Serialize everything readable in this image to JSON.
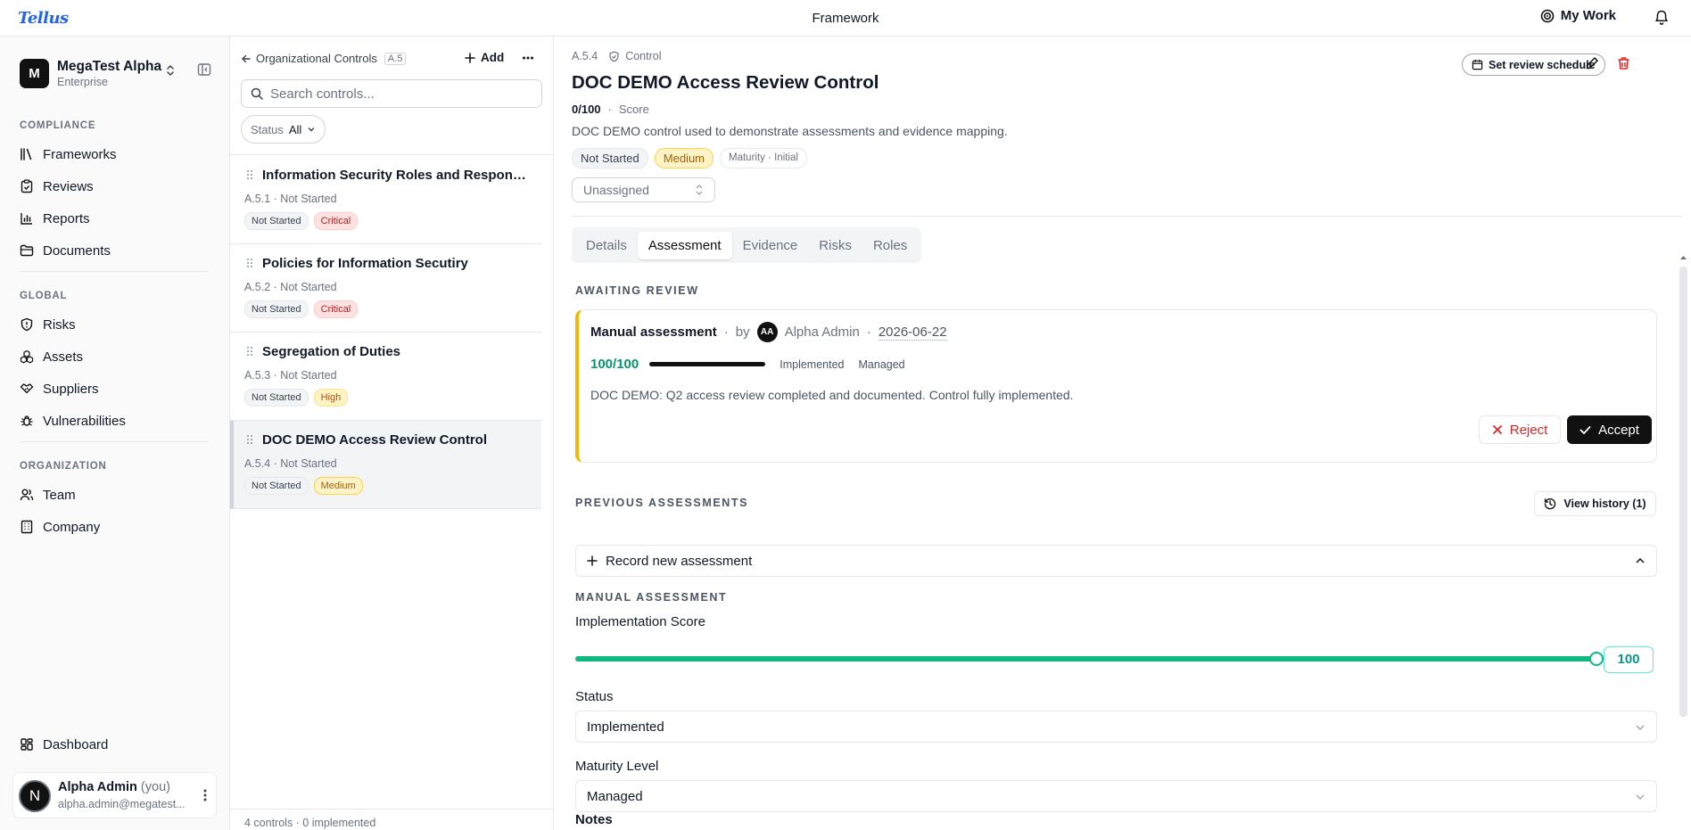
{
  "topbar": {
    "logo": "Tellus",
    "title": "Framework",
    "my_work": "My Work"
  },
  "sidebar": {
    "org_initial": "M",
    "org_name": "MegaTest Alpha",
    "org_plan": "Enterprise",
    "sections": {
      "compliance": "COMPLIANCE",
      "global": "GLOBAL",
      "organization": "ORGANIZATION"
    },
    "compliance_items": [
      {
        "label": "Frameworks",
        "icon": "frameworks-icon"
      },
      {
        "label": "Reviews",
        "icon": "reviews-icon"
      },
      {
        "label": "Reports",
        "icon": "reports-icon"
      },
      {
        "label": "Documents",
        "icon": "documents-icon"
      }
    ],
    "global_items": [
      {
        "label": "Risks",
        "icon": "shield-icon"
      },
      {
        "label": "Assets",
        "icon": "assets-icon"
      },
      {
        "label": "Suppliers",
        "icon": "handshake-icon"
      },
      {
        "label": "Vulnerabilities",
        "icon": "bug-icon"
      }
    ],
    "org_items": [
      {
        "label": "Team",
        "icon": "team-icon"
      },
      {
        "label": "Company",
        "icon": "building-icon"
      }
    ],
    "dashboard": "Dashboard",
    "user": {
      "initial": "N",
      "name": "Alpha Admin",
      "you": "(you)",
      "email": "alpha.admin@megatest..."
    }
  },
  "list_panel": {
    "back_label": "Organizational Controls",
    "ref": "A.5",
    "add_label": "Add",
    "search_placeholder": "Search controls...",
    "filter_label": "Status",
    "filter_value": "All",
    "controls": [
      {
        "title": "Information Security Roles and Responsib...",
        "meta": "A.5.1 · Not Started",
        "status": "Not Started",
        "priority": "Critical"
      },
      {
        "title": "Policies for Information Secutiry",
        "meta": "A.5.2 · Not Started",
        "status": "Not Started",
        "priority": "Critical"
      },
      {
        "title": "Segregation of Duties",
        "meta": "A.5.3 · Not Started",
        "status": "Not Started",
        "priority": "High"
      },
      {
        "title": "DOC DEMO Access Review Control",
        "meta": "A.5.4 · Not Started",
        "status": "Not Started",
        "priority": "Medium"
      }
    ],
    "footer": "4 controls · 0 implemented"
  },
  "detail": {
    "ref": "A.5.4",
    "kind": "Control",
    "title": "DOC DEMO Access Review Control",
    "score": "0/100",
    "score_sep": "·",
    "score_label": "Score",
    "description": "DOC DEMO control used to demonstrate assessments and evidence mapping.",
    "badges": {
      "status": "Not Started",
      "priority": "Medium",
      "maturity": "Maturity · Initial"
    },
    "assignee": "Unassigned",
    "review_schedule": "Set review schedule",
    "tabs": [
      "Details",
      "Assessment",
      "Evidence",
      "Risks",
      "Roles"
    ],
    "awaiting_review": "AWAITING REVIEW",
    "review": {
      "type": "Manual assessment",
      "sep1": "·",
      "by": "by",
      "reviewer_initials": "AA",
      "reviewer": "Alpha Admin",
      "sep2": "·",
      "date": "2026-06-22",
      "score": "100/100",
      "score_pct": 100,
      "status": "Implemented",
      "maturity": "Managed",
      "note": "DOC DEMO: Q2 access review completed and documented. Control fully implemented.",
      "reject": "Reject",
      "accept": "Accept"
    },
    "previous_assessments": "PREVIOUS ASSESSMENTS",
    "view_history": "View history (1)",
    "record_new": "Record new assessment",
    "manual_assessment": "MANUAL ASSESSMENT",
    "form": {
      "score_label": "Implementation Score",
      "score_value": "100",
      "score_pct": 100,
      "status_label": "Status",
      "status_value": "Implemented",
      "maturity_label": "Maturity Level",
      "maturity_value": "Managed",
      "notes_label": "Notes"
    }
  },
  "colors": {
    "accent_green": "#10b981",
    "review_border": "#f5b700",
    "danger": "#dc2626",
    "logo_blue": "#2563eb"
  }
}
